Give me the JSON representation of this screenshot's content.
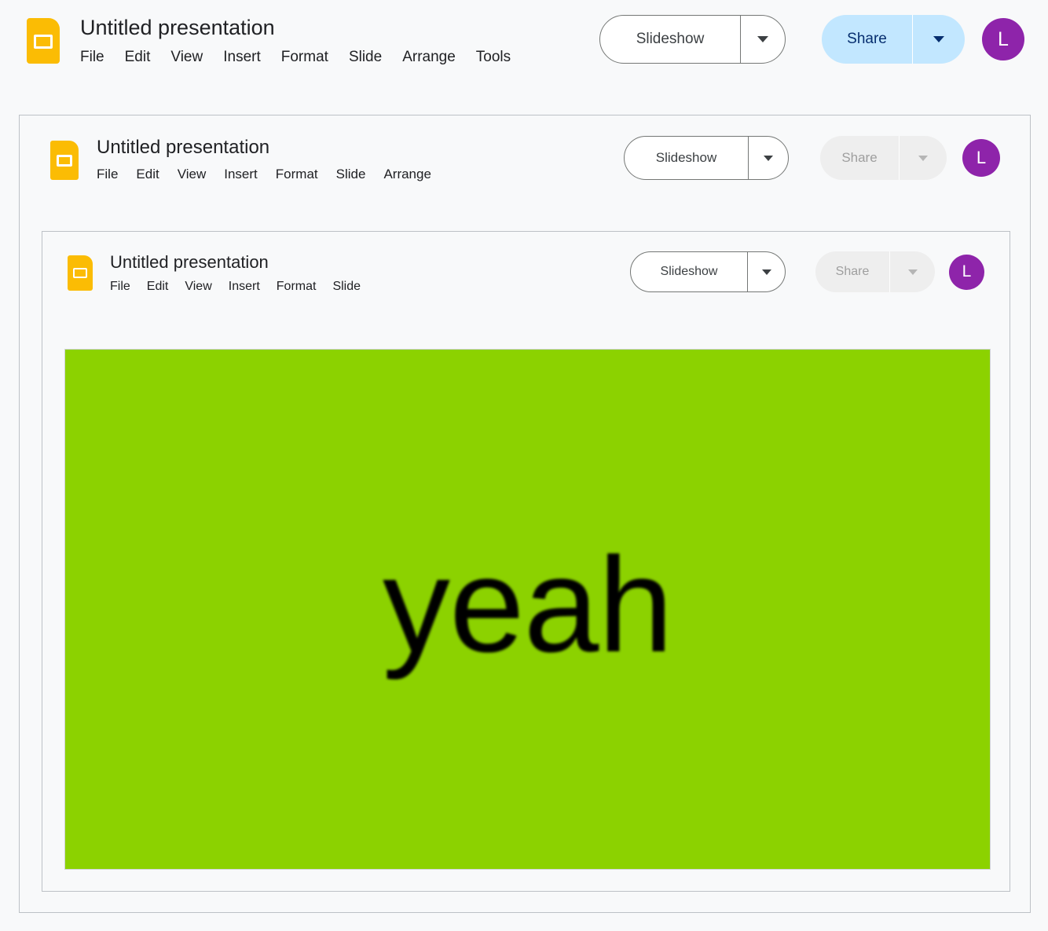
{
  "app": {
    "name": "Google Slides",
    "logo_icon": "slides-logo-icon",
    "logo_color": "#fbbc04",
    "page_background": "#f8f9fa",
    "panel_border_color": "#bdc1c6"
  },
  "levels": [
    {
      "id": "level1",
      "title": "Untitled presentation",
      "menus": [
        "File",
        "Edit",
        "View",
        "Insert",
        "Format",
        "Slide",
        "Arrange",
        "Tools"
      ],
      "slideshow": {
        "label": "Slideshow",
        "dropdown_icon": "chevron-down-icon",
        "background": "#ffffff",
        "border_color": "#747775",
        "text_color": "#3c4043"
      },
      "share": {
        "label": "Share",
        "dropdown_icon": "chevron-down-icon",
        "state": "enabled",
        "background": "#c2e7ff",
        "text_color": "#062e6f"
      },
      "avatar": {
        "initial": "L",
        "background": "#8e24aa",
        "text_color": "#ffffff"
      }
    },
    {
      "id": "level2",
      "title": "Untitled presentation",
      "menus": [
        "File",
        "Edit",
        "View",
        "Insert",
        "Format",
        "Slide",
        "Arrange"
      ],
      "slideshow": {
        "label": "Slideshow",
        "dropdown_icon": "chevron-down-icon",
        "background": "#ffffff",
        "border_color": "#747775",
        "text_color": "#3c4043"
      },
      "share": {
        "label": "Share",
        "dropdown_icon": "chevron-down-icon",
        "state": "disabled",
        "background": "#eeeeee",
        "text_color": "#9e9e9e"
      },
      "avatar": {
        "initial": "L",
        "background": "#8e24aa",
        "text_color": "#ffffff"
      }
    },
    {
      "id": "level3",
      "title": "Untitled presentation",
      "menus": [
        "File",
        "Edit",
        "View",
        "Insert",
        "Format",
        "Slide"
      ],
      "slideshow": {
        "label": "Slideshow",
        "dropdown_icon": "chevron-down-icon",
        "background": "#ffffff",
        "border_color": "#747775",
        "text_color": "#3c4043"
      },
      "share": {
        "label": "Share",
        "dropdown_icon": "chevron-down-icon",
        "state": "disabled",
        "background": "#eeeeee",
        "text_color": "#9e9e9e"
      },
      "avatar": {
        "initial": "L",
        "background": "#8e24aa",
        "text_color": "#ffffff"
      }
    }
  ],
  "slide": {
    "text": "yeah",
    "background_color": "#8cd200",
    "text_color": "#000000",
    "border_color": "#d0d3d6"
  }
}
